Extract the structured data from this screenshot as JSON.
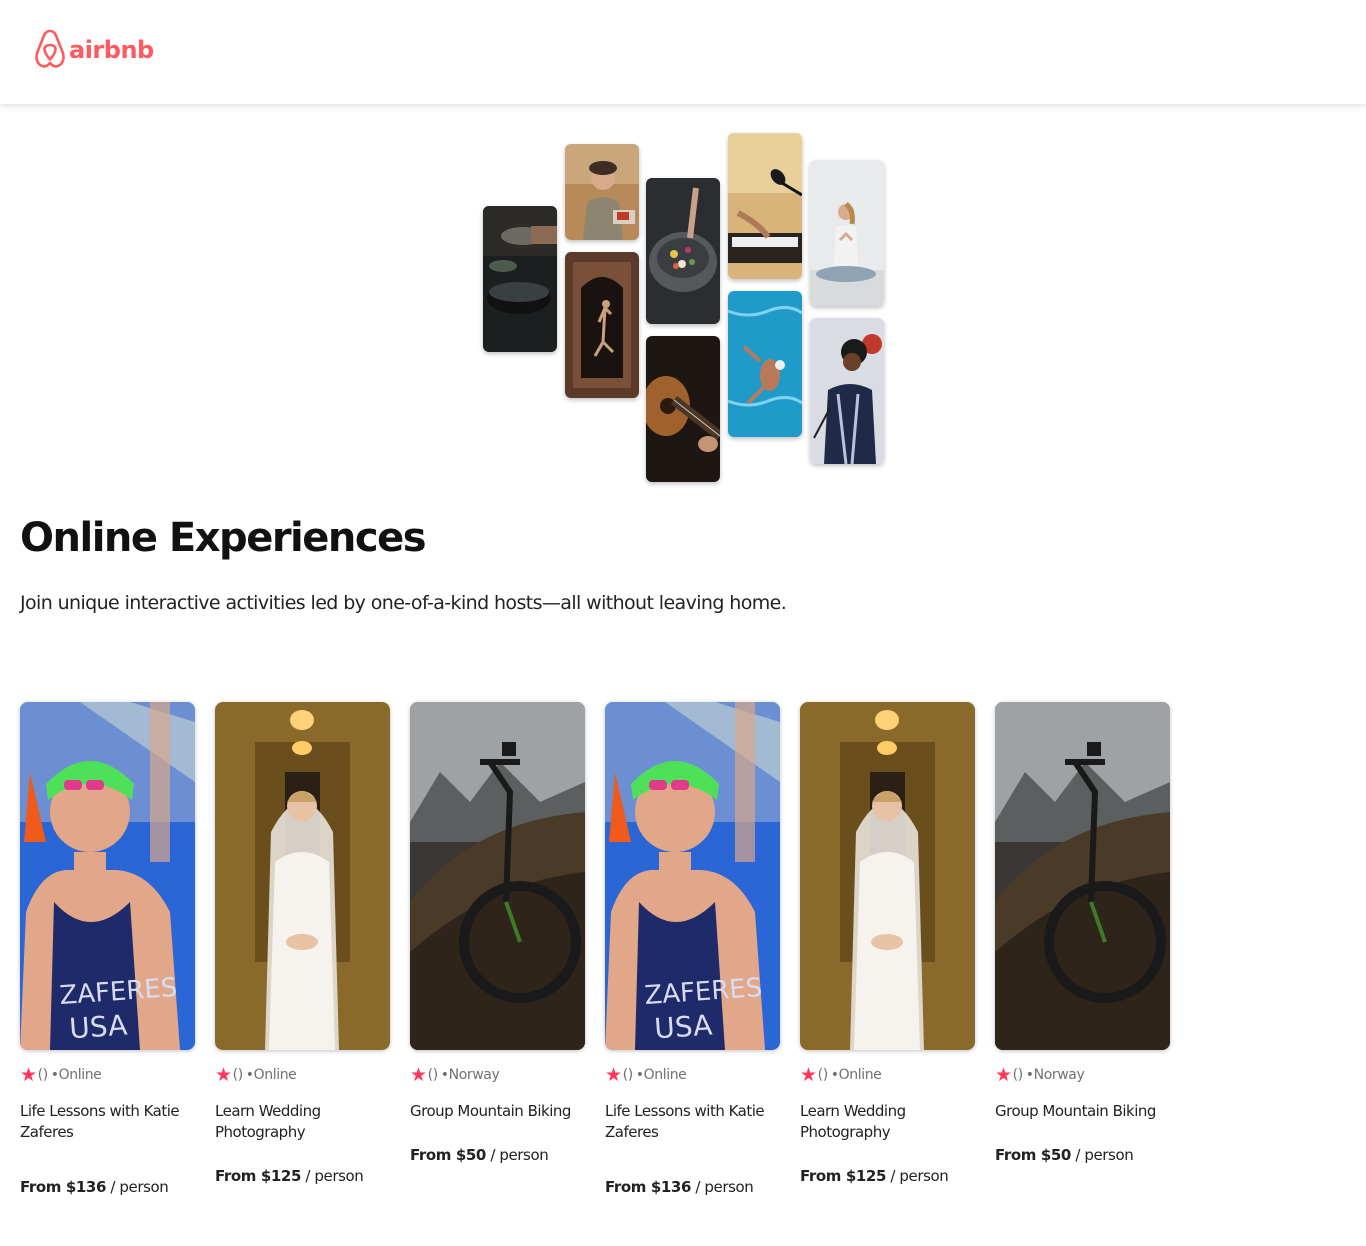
{
  "brand": {
    "name": "airbnb",
    "color": "#ff5a5f",
    "icon": "airbnb-belo-icon"
  },
  "hero": {
    "title": "Online Experiences",
    "subtitle": "Join unique interactive activities led by one-of-a-kind hosts—all without leaving home.",
    "collage_images": [
      "cooking-pots-photo",
      "woman-cooking-photo",
      "dancer-doorway-photo",
      "gourmet-bowl-photo",
      "guitar-player-photo",
      "piano-microphone-photo",
      "swimmer-pool-photo",
      "yoga-meditation-photo",
      "singer-performing-photo"
    ]
  },
  "accent_color": "#ff385c",
  "experiences": [
    {
      "image": "katie-zaferes-photo",
      "rating": "()",
      "location": "•Online",
      "title": "Life Lessons with Katie Zaferes",
      "price_prefix": "From $136",
      "price_suffix": " / person"
    },
    {
      "image": "wedding-bride-photo",
      "rating": "()",
      "location": "•Online",
      "title": "Learn Wedding Photography",
      "price_prefix": "From $125",
      "price_suffix": " / person"
    },
    {
      "image": "mountain-bike-photo",
      "rating": "()",
      "location": "•Norway",
      "title": "Group Mountain Biking",
      "price_prefix": "From $50",
      "price_suffix": " / person"
    },
    {
      "image": "katie-zaferes-photo",
      "rating": "()",
      "location": "•Online",
      "title": "Life Lessons with Katie Zaferes",
      "price_prefix": "From $136",
      "price_suffix": " / person"
    },
    {
      "image": "wedding-bride-photo",
      "rating": "()",
      "location": "•Online",
      "title": "Learn Wedding Photography",
      "price_prefix": "From $125",
      "price_suffix": " / person"
    },
    {
      "image": "mountain-bike-photo",
      "rating": "()",
      "location": "•Norway",
      "title": "Group Mountain Biking",
      "price_prefix": "From $50",
      "price_suffix": " / person"
    }
  ]
}
